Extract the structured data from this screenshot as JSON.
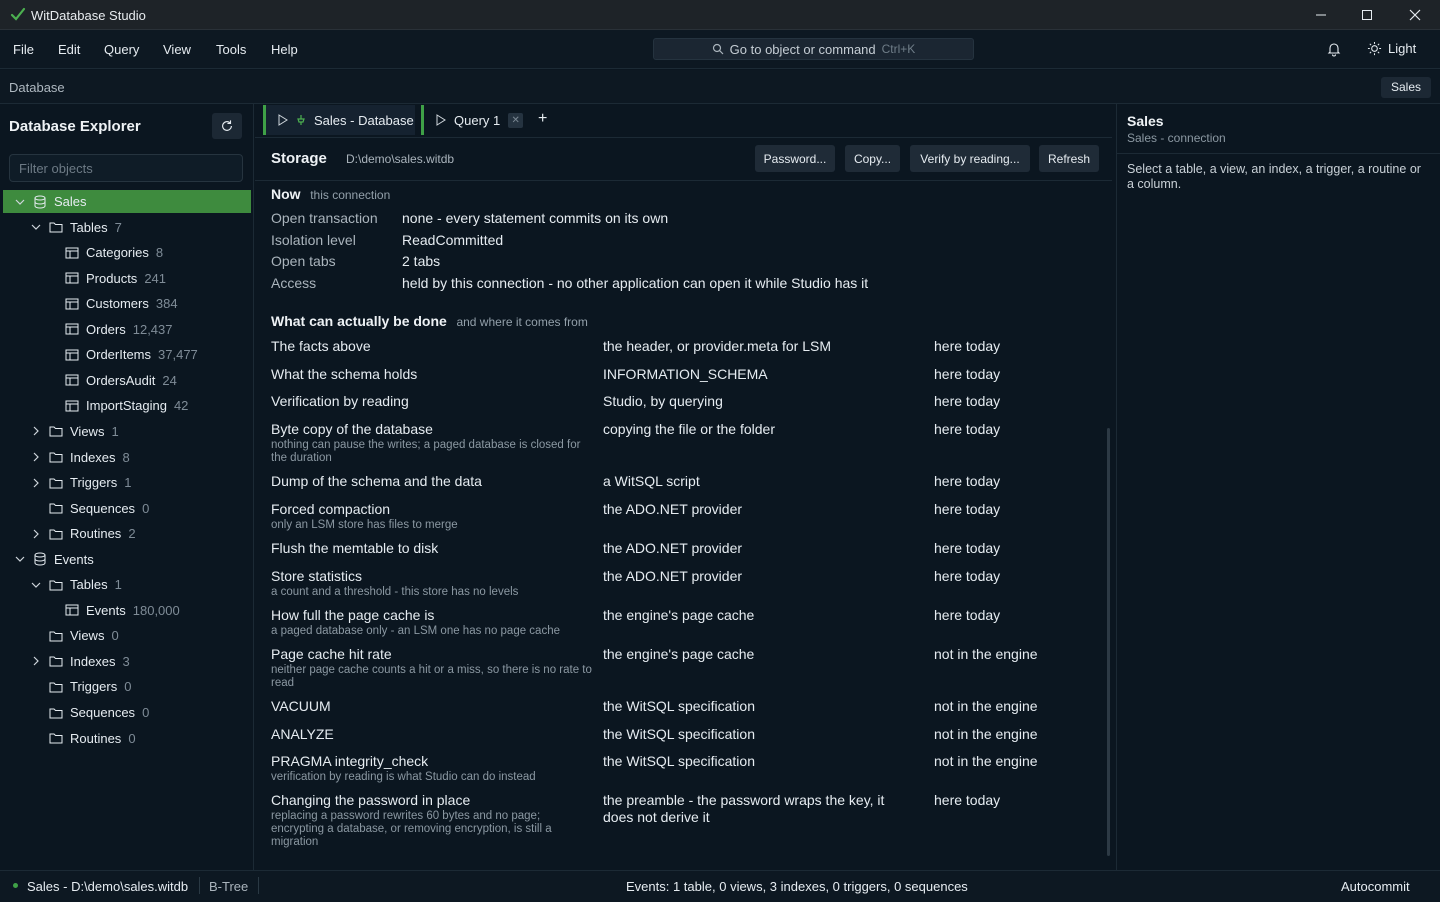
{
  "window": {
    "title": "WitDatabase Studio"
  },
  "menu": [
    "File",
    "Edit",
    "Query",
    "View",
    "Tools",
    "Help"
  ],
  "command_search": {
    "placeholder": "Go to object or command",
    "shortcut": "Ctrl+K"
  },
  "theme_toggle": "Light",
  "breadcrumb": "Database",
  "connection_chip": "Sales",
  "explorer": {
    "title": "Database Explorer",
    "filter_placeholder": "Filter objects",
    "tree": [
      {
        "label": "Sales",
        "count": "",
        "depth": 0,
        "type": "db",
        "state": "open",
        "selected": true
      },
      {
        "label": "Tables",
        "count": "7",
        "depth": 1,
        "type": "folder",
        "state": "open"
      },
      {
        "label": "Categories",
        "count": "8",
        "depth": 2,
        "type": "table",
        "state": "none"
      },
      {
        "label": "Products",
        "count": "241",
        "depth": 2,
        "type": "table",
        "state": "none"
      },
      {
        "label": "Customers",
        "count": "384",
        "depth": 2,
        "type": "table",
        "state": "none"
      },
      {
        "label": "Orders",
        "count": "12,437",
        "depth": 2,
        "type": "table",
        "state": "none"
      },
      {
        "label": "OrderItems",
        "count": "37,477",
        "depth": 2,
        "type": "table",
        "state": "none"
      },
      {
        "label": "OrdersAudit",
        "count": "24",
        "depth": 2,
        "type": "table",
        "state": "none"
      },
      {
        "label": "ImportStaging",
        "count": "42",
        "depth": 2,
        "type": "table",
        "state": "none"
      },
      {
        "label": "Views",
        "count": "1",
        "depth": 1,
        "type": "folder",
        "state": "closed"
      },
      {
        "label": "Indexes",
        "count": "8",
        "depth": 1,
        "type": "folder",
        "state": "closed"
      },
      {
        "label": "Triggers",
        "count": "1",
        "depth": 1,
        "type": "folder",
        "state": "closed"
      },
      {
        "label": "Sequences",
        "count": "0",
        "depth": 1,
        "type": "folder",
        "state": "none"
      },
      {
        "label": "Routines",
        "count": "2",
        "depth": 1,
        "type": "folder",
        "state": "closed"
      },
      {
        "label": "Events",
        "count": "",
        "depth": 0,
        "type": "db",
        "state": "open"
      },
      {
        "label": "Tables",
        "count": "1",
        "depth": 1,
        "type": "folder",
        "state": "open"
      },
      {
        "label": "Events",
        "count": "180,000",
        "depth": 2,
        "type": "table",
        "state": "none"
      },
      {
        "label": "Views",
        "count": "0",
        "depth": 1,
        "type": "folder",
        "state": "none"
      },
      {
        "label": "Indexes",
        "count": "3",
        "depth": 1,
        "type": "folder",
        "state": "closed"
      },
      {
        "label": "Triggers",
        "count": "0",
        "depth": 1,
        "type": "folder",
        "state": "none"
      },
      {
        "label": "Sequences",
        "count": "0",
        "depth": 1,
        "type": "folder",
        "state": "none"
      },
      {
        "label": "Routines",
        "count": "0",
        "depth": 1,
        "type": "folder",
        "state": "none"
      }
    ]
  },
  "tabs": [
    {
      "label": "Sales - Database",
      "active": true
    },
    {
      "label": "Query 1",
      "active": false
    }
  ],
  "storage": {
    "title": "Storage",
    "path": "D:\\demo\\sales.witdb",
    "buttons": [
      "Password...",
      "Copy...",
      "Verify by reading...",
      "Refresh"
    ]
  },
  "now": {
    "heading": "Now",
    "sub": "this connection",
    "rows": [
      {
        "key": "Open transaction",
        "value": "none - every statement commits on its own"
      },
      {
        "key": "Isolation level",
        "value": "ReadCommitted"
      },
      {
        "key": "Open tabs",
        "value": "2 tabs"
      },
      {
        "key": "Access",
        "value": "held by this connection - no other application can open it while Studio has it"
      }
    ]
  },
  "capabilities": {
    "heading": "What can actually be done",
    "sub": "and where it comes from",
    "rows": [
      {
        "feature": "The facts above",
        "note": "",
        "source": "the header, or provider.meta for LSM",
        "status": "here today"
      },
      {
        "feature": "What the schema holds",
        "note": "",
        "source": "INFORMATION_SCHEMA",
        "status": "here today"
      },
      {
        "feature": "Verification by reading",
        "note": "",
        "source": "Studio, by querying",
        "status": "here today"
      },
      {
        "feature": "Byte copy of the database",
        "note": "nothing can pause the writes; a paged database is closed for the duration",
        "source": "copying the file or the folder",
        "status": "here today"
      },
      {
        "feature": "Dump of the schema and the data",
        "note": "",
        "source": "a WitSQL script",
        "status": "here today"
      },
      {
        "feature": "Forced compaction",
        "note": "only an LSM store has files to merge",
        "source": "the ADO.NET provider",
        "status": "here today"
      },
      {
        "feature": "Flush the memtable to disk",
        "note": "",
        "source": "the ADO.NET provider",
        "status": "here today"
      },
      {
        "feature": "Store statistics",
        "note": "a count and a threshold - this store has no levels",
        "source": "the ADO.NET provider",
        "status": "here today"
      },
      {
        "feature": "How full the page cache is",
        "note": "a paged database only - an LSM one has no page cache",
        "source": "the engine's page cache",
        "status": "here today"
      },
      {
        "feature": "Page cache hit rate",
        "note": "neither page cache counts a hit or a miss, so there is no rate to read",
        "source": "the engine's page cache",
        "status": "not in the engine"
      },
      {
        "feature": "VACUUM",
        "note": "",
        "source": "the WitSQL specification",
        "status": "not in the engine"
      },
      {
        "feature": "ANALYZE",
        "note": "",
        "source": "the WitSQL specification",
        "status": "not in the engine"
      },
      {
        "feature": "PRAGMA integrity_check",
        "note": "verification by reading is what Studio can do instead",
        "source": "the WitSQL specification",
        "status": "not in the engine"
      },
      {
        "feature": "Changing the password in place",
        "note": "replacing a password rewrites 60 bytes and no page; encrypting a database, or removing encryption, is still a migration",
        "source": "the preamble - the password wraps the key, it does not derive it",
        "status": "here today"
      }
    ]
  },
  "details_panel": {
    "title": "Sales",
    "subtitle": "Sales - connection",
    "hint": "Select a table, a view, an index, a trigger, a routine or a column."
  },
  "status_bar": {
    "connection": "Sales - D:\\demo\\sales.witdb",
    "engine": "B-Tree",
    "summary": "Events: 1 table, 0 views, 3 indexes, 0 triggers, 0 sequences",
    "mode": "Autocommit"
  },
  "colors": {
    "accent": "#3fa147",
    "background": "#0b1620",
    "panel": "#1f2b37"
  }
}
